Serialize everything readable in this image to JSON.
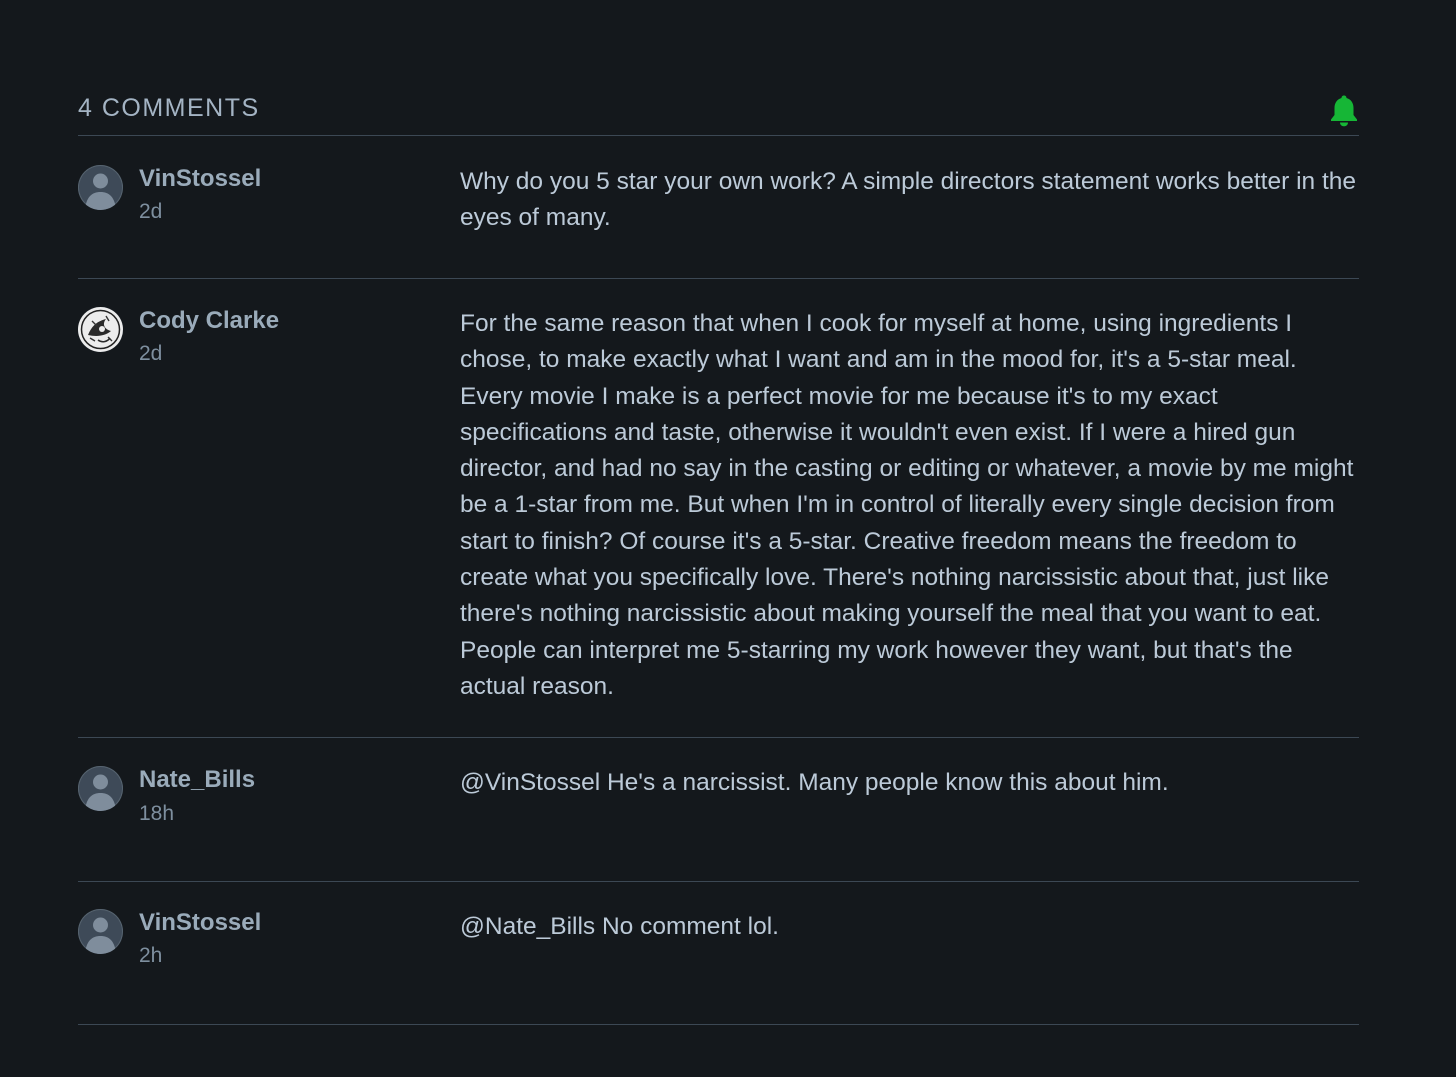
{
  "header": {
    "title": "4 COMMENTS",
    "bell_icon": "bell-icon",
    "bell_color": "#16b636"
  },
  "comments": [
    {
      "username": "VinStossel",
      "time": "2d",
      "avatar": "default-avatar-icon",
      "text": "Why do you 5 star your own work? A simple directors statement works better in the eyes of many."
    },
    {
      "username": "Cody Clarke",
      "time": "2d",
      "avatar": "custom-illustration-avatar",
      "text": "For the same reason that when I cook for myself at home, using ingredients I chose, to make exactly what I want and am in the mood for, it's a 5-star meal. Every movie I make is a perfect movie for me because it's to my exact specifications and taste, otherwise it wouldn't even exist. If I were a hired gun director, and had no say in the casting or editing or whatever, a movie by me might be a 1-star from me. But when I'm in control of literally every single decision from start to finish? Of course it's a 5-star. Creative freedom means the freedom to create what you specifically love. There's nothing narcissistic about that, just like there's nothing narcissistic about making yourself the meal that you want to eat. People can interpret me 5-starring my work however they want, but that's the actual reason."
    },
    {
      "username": "Nate_Bills",
      "time": "18h",
      "avatar": "default-avatar-icon",
      "text": "@VinStossel He's a narcissist. Many people know this about him."
    },
    {
      "username": "VinStossel",
      "time": "2h",
      "avatar": "default-avatar-icon",
      "text": "@Nate_Bills No comment lol."
    }
  ]
}
